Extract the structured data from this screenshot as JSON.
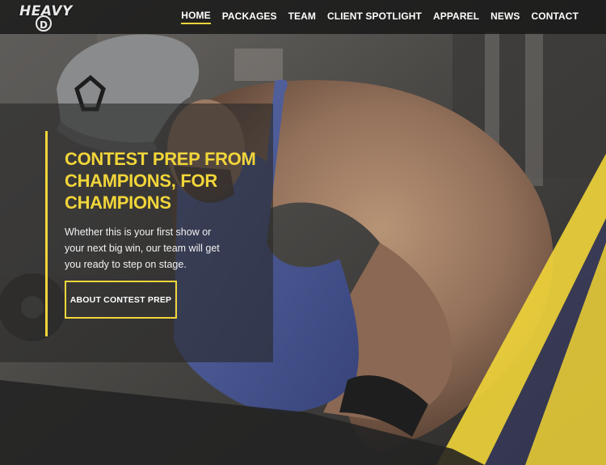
{
  "brand": {
    "logo_text": "HEAVY",
    "logo_badge": "D"
  },
  "nav": {
    "items": [
      {
        "label": "HOME",
        "active": true
      },
      {
        "label": "PACKAGES",
        "active": false
      },
      {
        "label": "TEAM",
        "active": false
      },
      {
        "label": "CLIENT SPOTLIGHT",
        "active": false
      },
      {
        "label": "APPAREL",
        "active": false
      },
      {
        "label": "NEWS",
        "active": false
      },
      {
        "label": "CONTACT",
        "active": false
      }
    ]
  },
  "hero": {
    "headline": "CONTEST PREP FROM CHAMPIONS, FOR CHAMPIONS",
    "subtext": "Whether this is your first show or your next big win, our team will get you ready to step on stage.",
    "cta_label": "ABOUT CONTEST PREP"
  },
  "colors": {
    "accent": "#f1d53a",
    "header_bg": "#161616",
    "text": "#ffffff"
  }
}
